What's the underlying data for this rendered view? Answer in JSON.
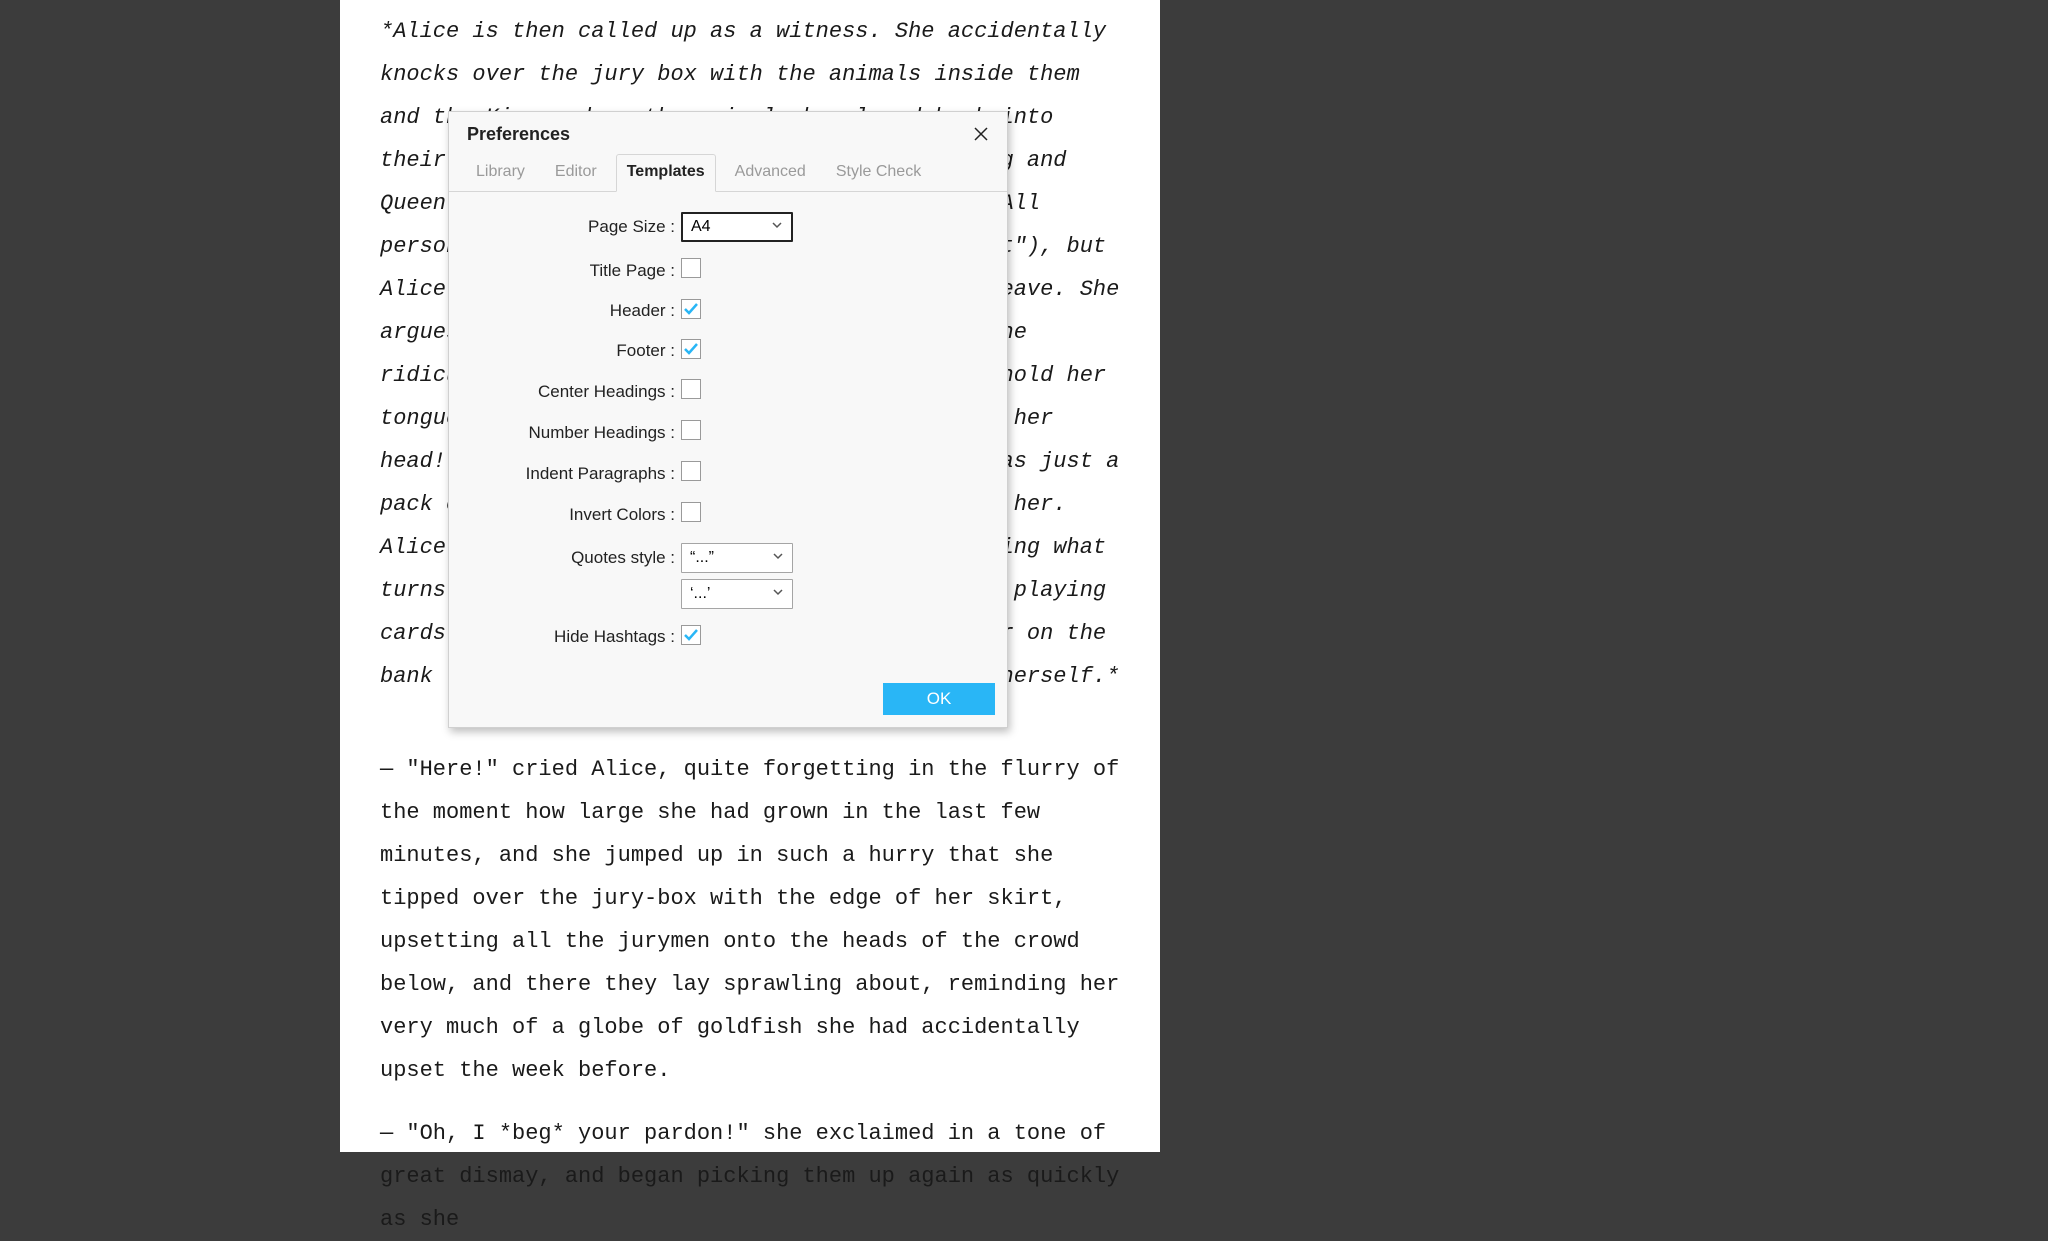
{
  "document": {
    "para1_italic": "*Alice is then called up as a witness. She accidentally knocks over the jury box with the animals inside them and the King orders the animals be placed back into their seats before the trial continues. The King and Queen order Alice to be gone, citing Rule 42 (\"All persons more than a mile high to leave the court\"), but Alice disputes their judgement and refuses to leave. She argues with the King and Queen of Hearts over the ridiculous proceedings, eventually refusing to hold her tongue. The Queen shouts her familiar \"Off with her head!\" but Alice is unafraid, calling them out as just a pack of cards; just as they start to swarm over her. Alice's sister wakes her up from a dream, brushing what turns out to be some leaves and not a shower of playing cards from Alice's face. Alice leaves her sister on the bank to imagine all the curious happenings for herself.*",
    "para2": "— \"Here!\" cried Alice, quite forgetting in the flurry of the moment how large she had grown in the last few minutes, and she jumped up in such a hurry that she tipped over the jury-box with the edge of her skirt, upsetting all the jurymen onto the heads of the crowd below, and there they lay sprawling about, reminding her very much of a globe of goldfish she had accidentally upset the week before.",
    "para3": "— \"Oh, I *beg* your pardon!\" she exclaimed in a tone of great dismay, and began picking them up again as quickly as she"
  },
  "dialog": {
    "title": "Preferences",
    "tabs": [
      {
        "label": "Library",
        "active": false
      },
      {
        "label": "Editor",
        "active": false
      },
      {
        "label": "Templates",
        "active": true
      },
      {
        "label": "Advanced",
        "active": false
      },
      {
        "label": "Style Check",
        "active": false
      }
    ],
    "fields": {
      "page_size": {
        "label": "Page Size :",
        "value": "A4"
      },
      "title_page": {
        "label": "Title Page :",
        "checked": false
      },
      "header": {
        "label": "Header :",
        "checked": true
      },
      "footer": {
        "label": "Footer :",
        "checked": true
      },
      "center_headings": {
        "label": "Center Headings :",
        "checked": false
      },
      "number_headings": {
        "label": "Number Headings :",
        "checked": false
      },
      "indent_paragraphs": {
        "label": "Indent Paragraphs :",
        "checked": false
      },
      "invert_colors": {
        "label": "Invert Colors :",
        "checked": false
      },
      "quotes_style": {
        "label": "Quotes style :",
        "value1": "“...”",
        "value2": "‘...’"
      },
      "hide_hashtags": {
        "label": "Hide Hashtags :",
        "checked": true
      }
    },
    "ok_label": "OK"
  },
  "colors": {
    "accent": "#29b6f6"
  }
}
